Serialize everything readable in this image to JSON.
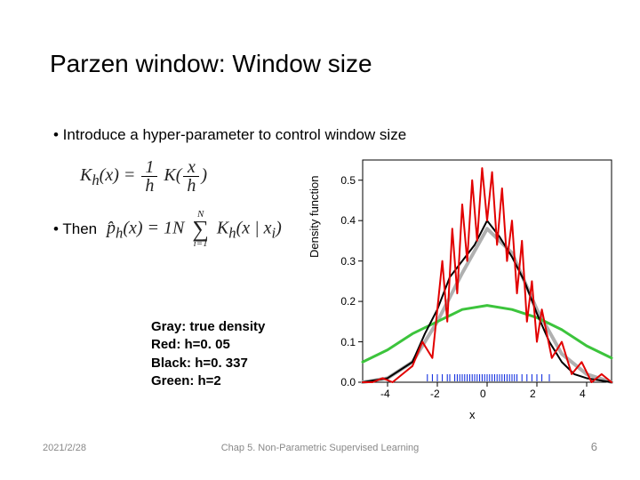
{
  "title": "Parzen window: Window size",
  "bullet1": "• Introduce a hyper-parameter to control window size",
  "eq1": {
    "lhs": "K",
    "sub": "h",
    "arg": "(x) =",
    "num1": "1",
    "den1": "h",
    "K": "K",
    "open": "(",
    "num2": "x",
    "den2": "h",
    "close": ")"
  },
  "bullet2": "• Then",
  "eq2": {
    "phat": "p̂",
    "sub": "h",
    "arg": "(x) =",
    "num1": "1",
    "den1": "N",
    "sumtop": "N",
    "sumbot": "i=1",
    "K": "K",
    "Ksub": "h",
    "body": "(x | x",
    "isub": "i",
    "close": ")"
  },
  "legend": {
    "l1": "Gray: true density",
    "l2": "Red: h=0. 05",
    "l3": "Black: h=0. 337",
    "l4": "Green: h=2"
  },
  "footer": {
    "date": "2021/2/28",
    "title": "Chap 5. Non-Parametric Supervised Learning",
    "page": "6"
  },
  "chart_data": {
    "type": "line",
    "xlabel": "x",
    "ylabel": "Density function",
    "xlim": [
      -5,
      5
    ],
    "ylim": [
      0,
      0.55
    ],
    "xticks": [
      -4,
      -2,
      0,
      2,
      4
    ],
    "yticks": [
      0.0,
      0.1,
      0.2,
      0.3,
      0.4,
      0.5
    ],
    "series": [
      {
        "name": "Gray: true density",
        "color": "#b0b0b0",
        "width": 4,
        "x": [
          -5,
          -4,
          -3,
          -2,
          -1,
          0,
          1,
          2,
          3,
          4,
          5
        ],
        "y": [
          0.0,
          0.01,
          0.05,
          0.15,
          0.27,
          0.38,
          0.32,
          0.18,
          0.07,
          0.02,
          0.0
        ]
      },
      {
        "name": "Green: h=2",
        "color": "#3cc43c",
        "width": 3,
        "x": [
          -5,
          -4,
          -3,
          -2,
          -1,
          0,
          1,
          2,
          3,
          4,
          5
        ],
        "y": [
          0.05,
          0.08,
          0.12,
          0.15,
          0.18,
          0.19,
          0.18,
          0.16,
          0.13,
          0.09,
          0.06
        ]
      },
      {
        "name": "Black: h=0.337",
        "color": "#000000",
        "width": 2,
        "x": [
          -5,
          -4.5,
          -4,
          -3.5,
          -3,
          -2.5,
          -2,
          -1.5,
          -1,
          -0.5,
          0,
          0.5,
          1,
          1.5,
          2,
          2.5,
          3,
          3.5,
          4,
          4.5,
          5
        ],
        "y": [
          0.0,
          0.005,
          0.01,
          0.03,
          0.05,
          0.12,
          0.18,
          0.26,
          0.3,
          0.34,
          0.4,
          0.36,
          0.31,
          0.25,
          0.17,
          0.1,
          0.05,
          0.02,
          0.01,
          0.005,
          0.0
        ]
      },
      {
        "name": "Red: h=0.05",
        "color": "#e20000",
        "width": 2,
        "x": [
          -5,
          -4.6,
          -4.2,
          -3.8,
          -3.4,
          -3.0,
          -2.6,
          -2.2,
          -1.8,
          -1.6,
          -1.4,
          -1.2,
          -1.0,
          -0.8,
          -0.6,
          -0.4,
          -0.2,
          0.0,
          0.2,
          0.4,
          0.6,
          0.8,
          1.0,
          1.2,
          1.4,
          1.6,
          1.8,
          2.0,
          2.2,
          2.6,
          3.0,
          3.4,
          3.8,
          4.2,
          4.6,
          5.0
        ],
        "y": [
          0.0,
          0.0,
          0.01,
          0.0,
          0.02,
          0.04,
          0.1,
          0.06,
          0.3,
          0.15,
          0.38,
          0.22,
          0.44,
          0.3,
          0.5,
          0.35,
          0.53,
          0.4,
          0.52,
          0.34,
          0.48,
          0.3,
          0.4,
          0.22,
          0.35,
          0.15,
          0.25,
          0.1,
          0.18,
          0.06,
          0.1,
          0.02,
          0.05,
          0.0,
          0.02,
          0.0
        ]
      }
    ],
    "rug": [
      -2.4,
      -2.2,
      -2.0,
      -1.8,
      -1.6,
      -1.5,
      -1.3,
      -1.2,
      -1.1,
      -1.0,
      -0.9,
      -0.8,
      -0.7,
      -0.6,
      -0.5,
      -0.4,
      -0.3,
      -0.2,
      -0.1,
      0.0,
      0.1,
      0.2,
      0.3,
      0.4,
      0.5,
      0.6,
      0.7,
      0.8,
      0.9,
      1.0,
      1.1,
      1.2,
      1.4,
      1.6,
      1.8,
      2.0,
      2.2,
      2.5
    ]
  }
}
